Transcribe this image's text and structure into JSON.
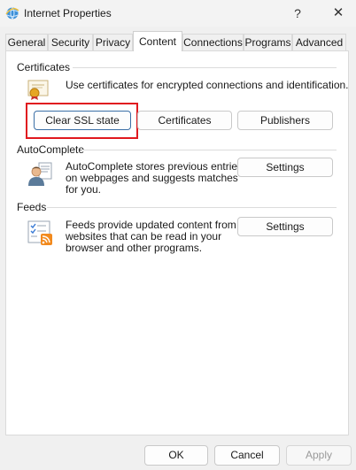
{
  "window": {
    "title": "Internet Properties",
    "help_glyph": "?",
    "close_glyph": "✕"
  },
  "tabs": [
    {
      "label": "General"
    },
    {
      "label": "Security"
    },
    {
      "label": "Privacy"
    },
    {
      "label": "Content",
      "active": true
    },
    {
      "label": "Connections"
    },
    {
      "label": "Programs"
    },
    {
      "label": "Advanced"
    }
  ],
  "certificates": {
    "group_title": "Certificates",
    "description": "Use certificates for encrypted connections and identification.",
    "clear_ssl_label": "Clear SSL state",
    "certificates_label": "Certificates",
    "publishers_label": "Publishers",
    "icon": "certificate-icon"
  },
  "autocomplete": {
    "group_title": "AutoComplete",
    "description_lines": [
      "AutoComplete stores previous entries",
      "on webpages and suggests matches",
      "for you."
    ],
    "settings_label": "Settings",
    "icon": "autocomplete-user-icon"
  },
  "feeds": {
    "group_title": "Feeds",
    "description_lines": [
      "Feeds provide updated content from",
      "websites that can be read in your",
      "browser and other programs."
    ],
    "settings_label": "Settings",
    "icon": "feeds-icon"
  },
  "footer": {
    "ok_label": "OK",
    "cancel_label": "Cancel",
    "apply_label": "Apply"
  },
  "colors": {
    "highlight": "#e0191f",
    "focus_border": "#3a6ea5",
    "rss_orange": "#f28a1e"
  }
}
